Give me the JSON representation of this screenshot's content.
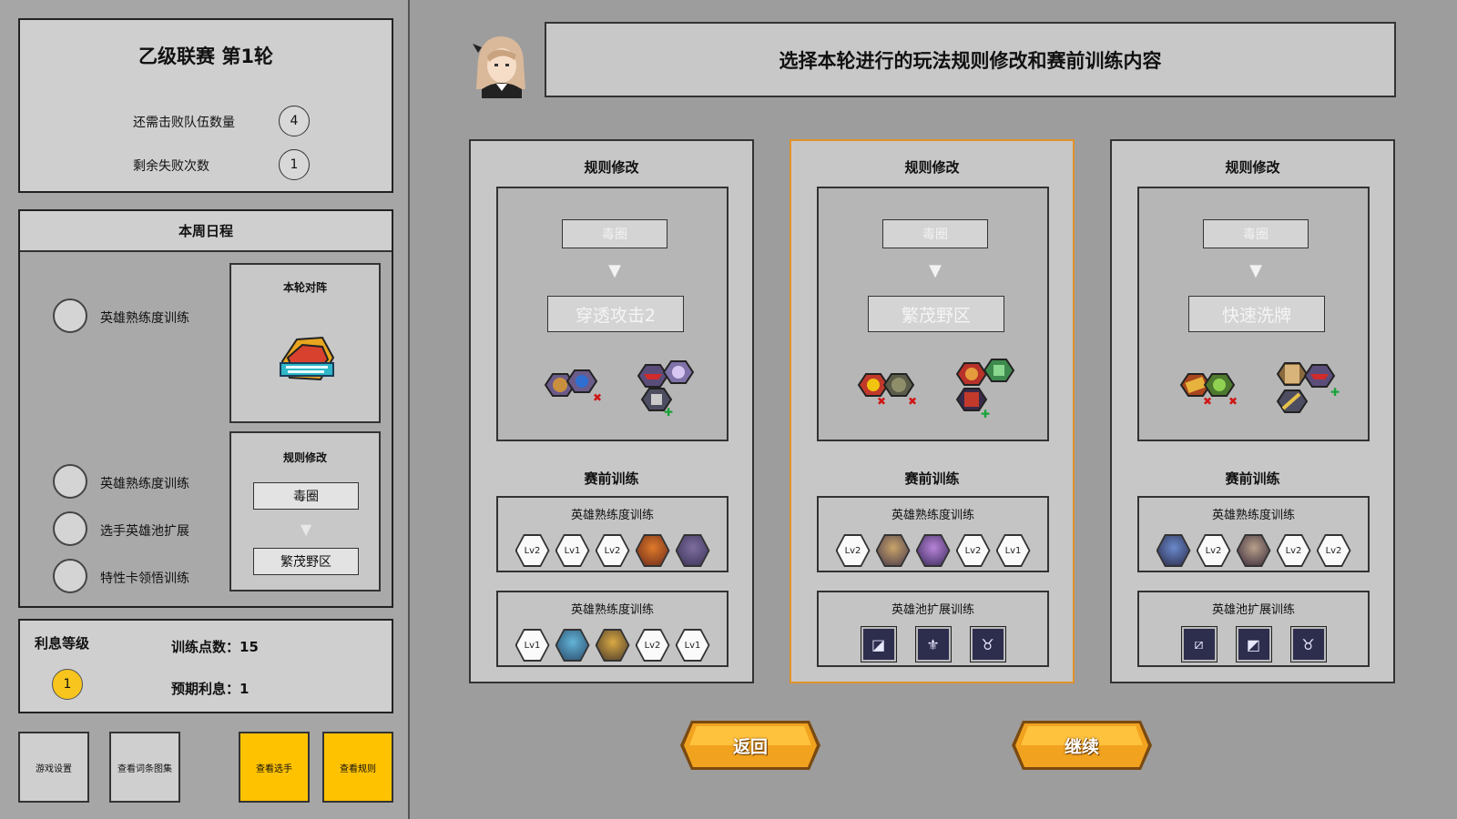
{
  "league": {
    "title": "乙级联赛 第1轮",
    "teams_to_defeat_label": "还需击败队伍数量",
    "teams_to_defeat": "4",
    "remaining_losses_label": "剩余失败次数",
    "remaining_losses": "1"
  },
  "schedule": {
    "title": "本周日程",
    "items": [
      {
        "label": "英雄熟练度训练"
      },
      {
        "label": "英雄熟练度训练"
      },
      {
        "label": "选手英雄池扩展"
      },
      {
        "label": "特性卡领悟训练"
      }
    ],
    "matchup_title": "本轮对阵",
    "opponent_logo_icon": "galaxy-raider-team-logo-icon",
    "rule_title": "规则修改",
    "rule_from": "毒圈",
    "rule_to": "繁茂野区"
  },
  "interest": {
    "level_label": "利息等级",
    "level": "1",
    "training_points": "训练点数：15",
    "expected_interest": "预期利息：1"
  },
  "bottom_buttons": {
    "game_settings": "游戏设置",
    "view_entries": "查看词条图集",
    "view_players": "查看选手",
    "view_rules": "查看规则"
  },
  "header": {
    "headline": "选择本轮进行的玩法规则修改和赛前训练内容"
  },
  "options": [
    {
      "title": "规则修改",
      "rule_from": "毒圈",
      "rule_to": "穿透攻击2",
      "training_title": "赛前训练",
      "trainings": [
        {
          "name": "英雄熟练度训练",
          "badges": [
            "Lv2",
            "Lv1",
            "Lv2",
            "hero-portrait-icon",
            "hero-portrait-icon"
          ]
        },
        {
          "name": "英雄熟练度训练",
          "badges": [
            "Lv1",
            "hero-portrait-icon",
            "hero-portrait-icon",
            "Lv2",
            "Lv1"
          ]
        }
      ]
    },
    {
      "title": "规则修改",
      "rule_from": "毒圈",
      "rule_to": "繁茂野区",
      "training_title": "赛前训练",
      "trainings": [
        {
          "name": "英雄熟练度训练",
          "badges": [
            "Lv2",
            "hero-portrait-icon",
            "hero-portrait-icon",
            "Lv2",
            "Lv1"
          ]
        },
        {
          "name": "英雄池扩展训练",
          "icons": [
            "expand-icon",
            "fleur-icon",
            "beast-icon"
          ]
        }
      ]
    },
    {
      "title": "规则修改",
      "rule_from": "毒圈",
      "rule_to": "快速洗牌",
      "training_title": "赛前训练",
      "trainings": [
        {
          "name": "英雄熟练度训练",
          "badges": [
            "hero-portrait-icon",
            "Lv2",
            "hero-portrait-icon",
            "Lv2",
            "Lv2"
          ]
        },
        {
          "name": "英雄池扩展训练",
          "icons": [
            "slash-icon",
            "stair-icon",
            "beast-icon"
          ]
        }
      ]
    }
  ],
  "actions": {
    "back": "返回",
    "continue": "继续"
  },
  "colors": {
    "accent_yellow": "#ffc200",
    "selected_border": "#e0922a",
    "button_orange": "#f1a21f"
  }
}
